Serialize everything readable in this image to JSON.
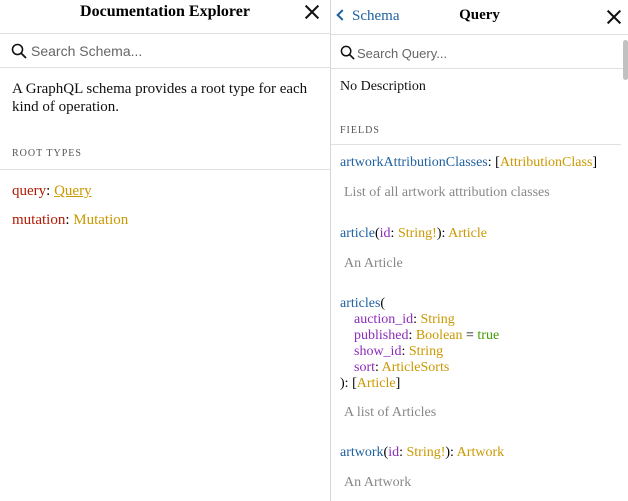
{
  "left_panel": {
    "title": "Documentation Explorer",
    "search_placeholder": "Search Schema...",
    "description": "A GraphQL schema provides a root type for each kind of operation.",
    "section_label": "ROOT TYPES",
    "root_types": [
      {
        "keyword": "query",
        "type": "Query"
      },
      {
        "keyword": "mutation",
        "type": "Mutation"
      }
    ]
  },
  "right_panel": {
    "back_label": "Schema",
    "title": "Query",
    "search_placeholder": "Search Query...",
    "no_description": "No Description",
    "section_label": "FIELDS",
    "fields": [
      {
        "name": "artworkAttributionClasses",
        "sep": ": ",
        "open": "[",
        "type": "AttributionClass",
        "close": "]",
        "description": "List of all artwork attribution classes"
      },
      {
        "name": "article",
        "args_inline": {
          "open": "(",
          "arg": "id",
          "sep": ": ",
          "type": "String!",
          "close": "): "
        },
        "type": "Article",
        "description": "An Article"
      },
      {
        "name": "articles",
        "open_paren": "(",
        "args": [
          {
            "name": "auction_id",
            "sep": ": ",
            "type": "String"
          },
          {
            "name": "published",
            "sep": ": ",
            "type": "Boolean",
            "default_sep": " = ",
            "default": "true"
          },
          {
            "name": "show_id",
            "sep": ": ",
            "type": "String"
          },
          {
            "name": "sort",
            "sep": ": ",
            "type": "ArticleSorts"
          }
        ],
        "close": "): ",
        "list_open": "[",
        "type": "Article",
        "list_close": "]",
        "description": "A list of Articles"
      },
      {
        "name": "artwork",
        "args_inline": {
          "open": "(",
          "arg": "id",
          "sep": ": ",
          "type": "String!",
          "close": "): "
        },
        "type": "Artwork",
        "description": "An Artwork"
      }
    ]
  },
  "icons": {
    "search": "search-icon",
    "close": "close-icon",
    "back": "chevron-left-icon"
  },
  "colors": {
    "keyword": "#b11a04",
    "type": "#ca9800",
    "field": "#1f61a0",
    "argument": "#8b2bb9",
    "default_value": "#439b00"
  }
}
